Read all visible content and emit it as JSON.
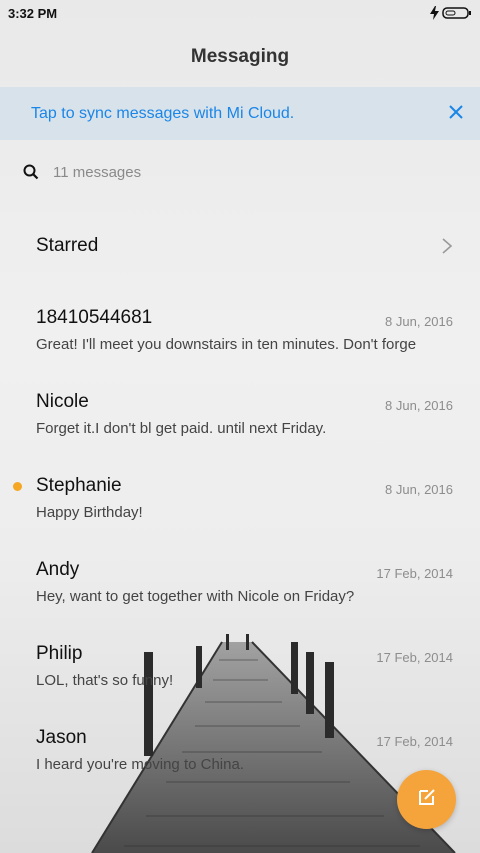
{
  "status_bar": {
    "time": "3:32 PM",
    "icons": [
      "charging-icon",
      "battery-icon"
    ]
  },
  "header": {
    "title": "Messaging"
  },
  "sync_banner": {
    "text": "Tap to sync messages with Mi Cloud.",
    "close_icon": "close-icon"
  },
  "search": {
    "icon": "search-icon",
    "placeholder": "11 messages"
  },
  "starred": {
    "label": "Starred",
    "icon": "chevron-right-icon"
  },
  "conversations": [
    {
      "name": "18410544681",
      "date": "8 Jun, 2016",
      "snippet": "Great! I'll meet you downstairs in ten minutes. Don't forge",
      "unread": false
    },
    {
      "name": "Nicole",
      "date": "8 Jun, 2016",
      "snippet": "Forget it.I don't bl get paid. until next Friday.",
      "unread": false
    },
    {
      "name": "Stephanie",
      "date": "8 Jun, 2016",
      "snippet": "Happy Birthday!",
      "unread": true
    },
    {
      "name": "Andy",
      "date": "17 Feb, 2014",
      "snippet": "Hey, want to get together with Nicole on Friday?",
      "unread": false
    },
    {
      "name": "Philip",
      "date": "17 Feb, 2014",
      "snippet": "LOL, that's so funny!",
      "unread": false
    },
    {
      "name": "Jason",
      "date": "17 Feb, 2014",
      "snippet": "I heard you're moving to China.",
      "unread": false
    }
  ],
  "fab": {
    "icon": "compose-icon"
  },
  "colors": {
    "accent": "#1a86e8",
    "fab": "#f5a43c",
    "unread_dot": "#f5a623",
    "banner_bg": "#d8e2ea"
  }
}
